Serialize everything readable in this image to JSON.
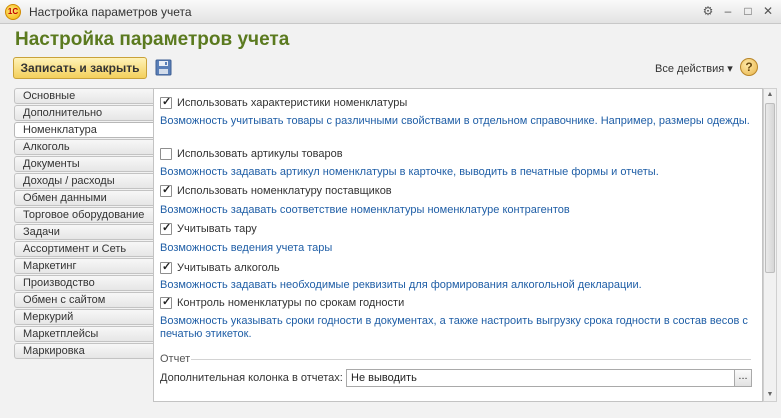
{
  "window": {
    "title": "Настройка параметров учета",
    "app_badge": "1С",
    "controls": [
      "⚙",
      "–",
      "□",
      "✕"
    ]
  },
  "header": {
    "title": "Настройка параметров учета"
  },
  "toolbar": {
    "write_close_label": "Записать и закрыть",
    "all_actions_label": "Все действия ▾",
    "help_label": "?"
  },
  "tabs": [
    {
      "label": "Основные",
      "active": false
    },
    {
      "label": "Дополнительно",
      "active": false
    },
    {
      "label": "Номенклатура",
      "active": true
    },
    {
      "label": "Алкоголь",
      "active": false
    },
    {
      "label": "Документы",
      "active": false
    },
    {
      "label": "Доходы / расходы",
      "active": false
    },
    {
      "label": "Обмен данными",
      "active": false
    },
    {
      "label": "Торговое оборудование",
      "active": false
    },
    {
      "label": "Задачи",
      "active": false
    },
    {
      "label": "Ассортимент и Сеть",
      "active": false
    },
    {
      "label": "Маркетинг",
      "active": false
    },
    {
      "label": "Производство",
      "active": false
    },
    {
      "label": "Обмен с сайтом",
      "active": false
    },
    {
      "label": "Меркурий",
      "active": false
    },
    {
      "label": "Маркетплейсы",
      "active": false
    },
    {
      "label": "Маркировка",
      "active": false
    }
  ],
  "settings": [
    {
      "label": "Использовать характеристики номенклатуры",
      "checked": true,
      "hint": "Возможность учитывать товары с различными свойствами в отдельном справочнике. Например, размеры одежды."
    },
    {
      "label": "Использовать артикулы товаров",
      "checked": false,
      "hint": "Возможность задавать артикул номенклатуры в карточке, выводить в печатные формы и отчеты."
    },
    {
      "label": "Использовать номенклатуру поставщиков",
      "checked": true,
      "hint": "Возможность задавать соответствие номенклатуры номенклатуре контрагентов"
    },
    {
      "label": "Учитывать тару",
      "checked": true,
      "hint": "Возможность ведения учета тары"
    },
    {
      "label": "Учитывать алкоголь",
      "checked": true,
      "hint": "Возможность задавать необходимые реквизиты для формирования алкогольной декларации."
    },
    {
      "label": "Контроль номенклатуры по срокам годности",
      "checked": true,
      "hint": "Возможность указывать сроки годности в документах, а также настроить выгрузку срока годности в состав весов с печатью этикеток."
    }
  ],
  "report_group": {
    "title": "Отчет",
    "field_label": "Дополнительная колонка в отчетах:",
    "field_value": "Не выводить",
    "field_button": "..."
  }
}
